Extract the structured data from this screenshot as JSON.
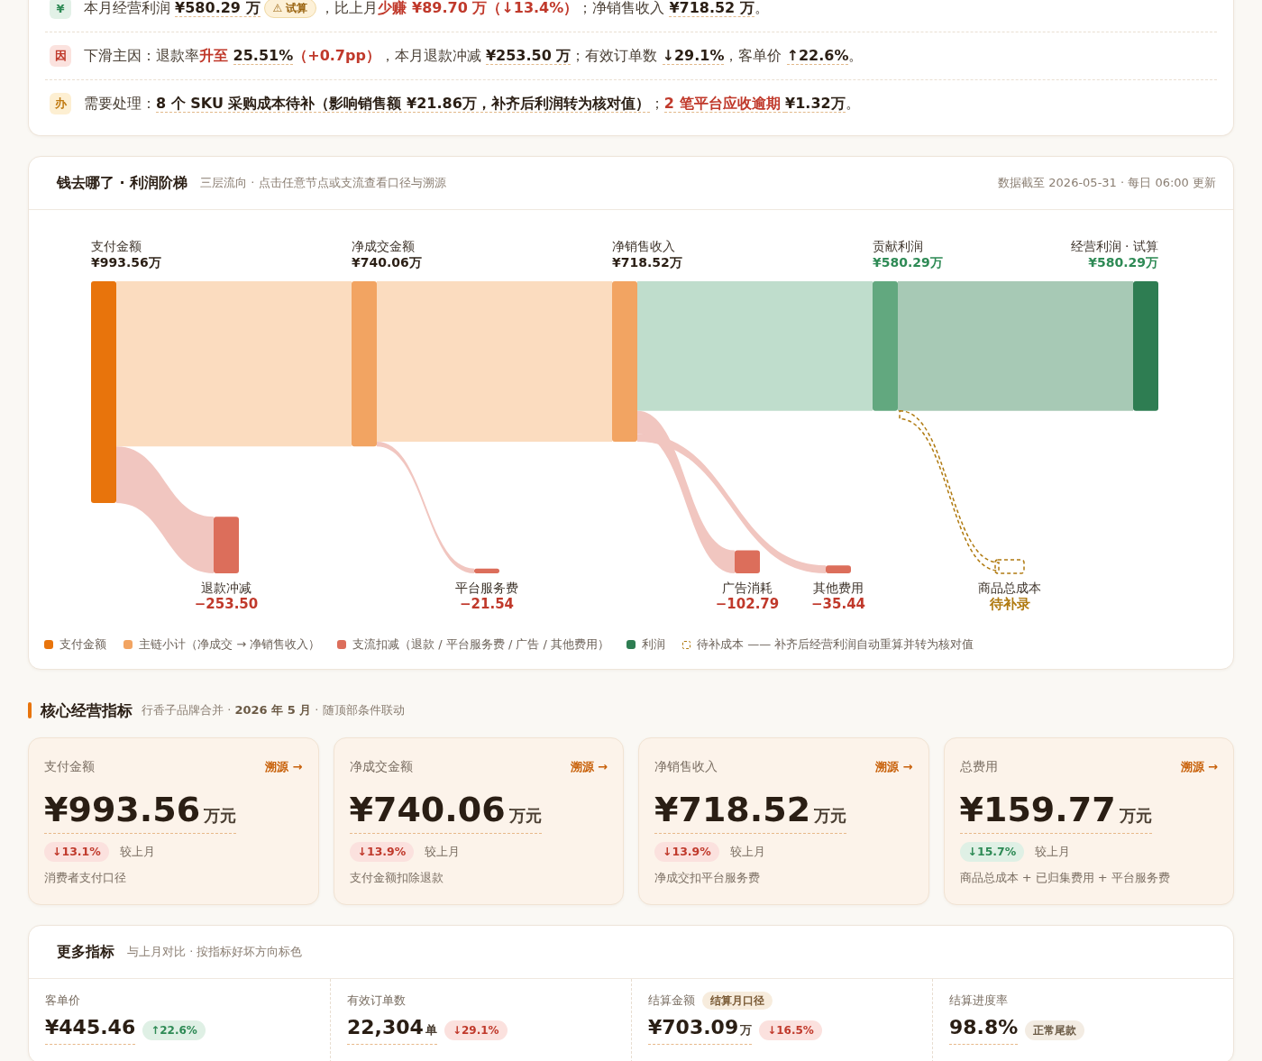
{
  "summary": {
    "rows": [
      {
        "tile": {
          "text": "¥",
          "kind": "good"
        },
        "segments": [
          {
            "text": "本月经营利润 ",
            "kind": "plain"
          },
          {
            "text": "¥580.29 万",
            "kind": "link"
          },
          {
            "text": "⚠ 试算",
            "kind": "badge"
          },
          {
            "text": "，比上月",
            "kind": "plain"
          },
          {
            "text": "少赚 ¥89.70 万（↓13.4%）",
            "kind": "alert"
          },
          {
            "text": "；净销售收入 ",
            "kind": "plain"
          },
          {
            "text": "¥718.52 万",
            "kind": "link"
          },
          {
            "text": "。",
            "kind": "plain"
          }
        ]
      },
      {
        "tile": {
          "text": "因",
          "kind": "bad"
        },
        "segments": [
          {
            "text": "下滑主因：退款率",
            "kind": "plain"
          },
          {
            "text": "升至 ",
            "kind": "alert"
          },
          {
            "text": "25.51%",
            "kind": "link"
          },
          {
            "text": "（+0.7pp）",
            "kind": "alert"
          },
          {
            "text": "，本月退款冲减 ",
            "kind": "plain"
          },
          {
            "text": "¥253.50 万",
            "kind": "link"
          },
          {
            "text": "；有效订单数 ",
            "kind": "plain"
          },
          {
            "text": "↓29.1%",
            "kind": "link"
          },
          {
            "text": "，客单价 ",
            "kind": "plain"
          },
          {
            "text": "↑22.6%",
            "kind": "link"
          },
          {
            "text": "。",
            "kind": "plain"
          }
        ]
      },
      {
        "tile": {
          "text": "办",
          "kind": "warn"
        },
        "segments": [
          {
            "text": "需要处理：",
            "kind": "plain"
          },
          {
            "text": "8 个 SKU 采购成本待补（影响销售额 ¥21.86万，补齐后利润转为核对值）",
            "kind": "link"
          },
          {
            "text": "；",
            "kind": "plain"
          },
          {
            "text": "2 笔平台应收逾期 ",
            "kind": "alert_link"
          },
          {
            "text": "¥1.32万",
            "kind": "link"
          },
          {
            "text": "。",
            "kind": "plain"
          }
        ]
      }
    ]
  },
  "sankey": {
    "title": "钱去哪了 · 利润阶梯",
    "subtitle": "三层流向 · 点击任意节点或支流查看口径与溯源",
    "updated": "数据截至 2026-05-31 · 每日 06:00 更新",
    "nodes": [
      {
        "label": "支付金额",
        "value": "¥993.56万",
        "kind": "gross",
        "branches": [
          {
            "label": "退款冲减",
            "value": "−253.50",
            "kind": "deduction"
          }
        ]
      },
      {
        "label": "净成交金额",
        "value": "¥740.06万",
        "kind": "subtotal",
        "branches": [
          {
            "label": "平台服务费",
            "value": "−21.54",
            "kind": "deduction"
          }
        ]
      },
      {
        "label": "净销售收入",
        "value": "¥718.52万",
        "kind": "subtotal",
        "branches": [
          {
            "label": "广告消耗",
            "value": "−102.79",
            "kind": "deduction"
          },
          {
            "label": "其他费用",
            "value": "−35.44",
            "kind": "deduction"
          }
        ]
      },
      {
        "label": "贡献利润",
        "value": "¥580.29万",
        "kind": "profit",
        "branches": [
          {
            "label": "商品总成本",
            "value": "待补录",
            "kind": "pending"
          }
        ]
      },
      {
        "label": "经营利润 · 试算",
        "value": "¥580.29万",
        "kind": "profit_final"
      }
    ],
    "legend": [
      {
        "label": "支付金额",
        "color": "#e8740c",
        "kind": "dot"
      },
      {
        "label": "主链小计（净成交 → 净销售收入）",
        "color": "#f2a462",
        "kind": "dot"
      },
      {
        "label": "支流扣减（退款 / 平台服务费 / 广告 / 其他费用）",
        "color": "#dc6e5b",
        "kind": "dot"
      },
      {
        "label": "利润",
        "color": "#2e7d52",
        "kind": "dot"
      },
      {
        "label": "待补成本 —— 补齐后经营利润自动重算并转为核对值",
        "color": "#b07a10",
        "kind": "dashed"
      }
    ]
  },
  "core_metrics": {
    "title": "核心经营指标",
    "subtitle": "行香子品牌合并 · **2026 年 5 月** · 随顶部条件联动",
    "cards": [
      {
        "label": "支付金额",
        "trace": "溯源 →",
        "value": "¥993.56",
        "unit": "万元",
        "delta": {
          "text": "↓13.1%",
          "kind": "bad"
        },
        "compare": "较上月",
        "note": "消费者支付口径"
      },
      {
        "label": "净成交金额",
        "trace": "溯源 →",
        "value": "¥740.06",
        "unit": "万元",
        "delta": {
          "text": "↓13.9%",
          "kind": "bad"
        },
        "compare": "较上月",
        "note": "支付金额扣除退款"
      },
      {
        "label": "净销售收入",
        "trace": "溯源 →",
        "value": "¥718.52",
        "unit": "万元",
        "delta": {
          "text": "↓13.9%",
          "kind": "bad"
        },
        "compare": "较上月",
        "note": "净成交扣平台服务费"
      },
      {
        "label": "总费用",
        "trace": "溯源 →",
        "value": "¥159.77",
        "unit": "万元",
        "delta": {
          "text": "↓15.7%",
          "kind": "good"
        },
        "compare": "较上月",
        "note": "商品总成本 + 已归集费用 + 平台服务费"
      }
    ]
  },
  "more_metrics": {
    "title": "更多指标",
    "subtitle": "与上月对比 · 按指标好坏方向标色",
    "cells": [
      {
        "label": "客单价",
        "value": "¥445.46",
        "delta": {
          "text": "↑22.6%",
          "kind": "good"
        }
      },
      {
        "label": "有效订单数",
        "value": "22,304",
        "unit": "单",
        "delta": {
          "text": "↓29.1%",
          "kind": "bad"
        }
      },
      {
        "label": "结算金额",
        "tag": "结算月口径",
        "value": "¥703.09",
        "unit": "万",
        "delta": {
          "text": "↓16.5%",
          "kind": "bad"
        }
      },
      {
        "label": "结算进度率",
        "value": "98.8%",
        "delta": {
          "text": "正常尾款",
          "kind": "neutral"
        }
      }
    ]
  }
}
